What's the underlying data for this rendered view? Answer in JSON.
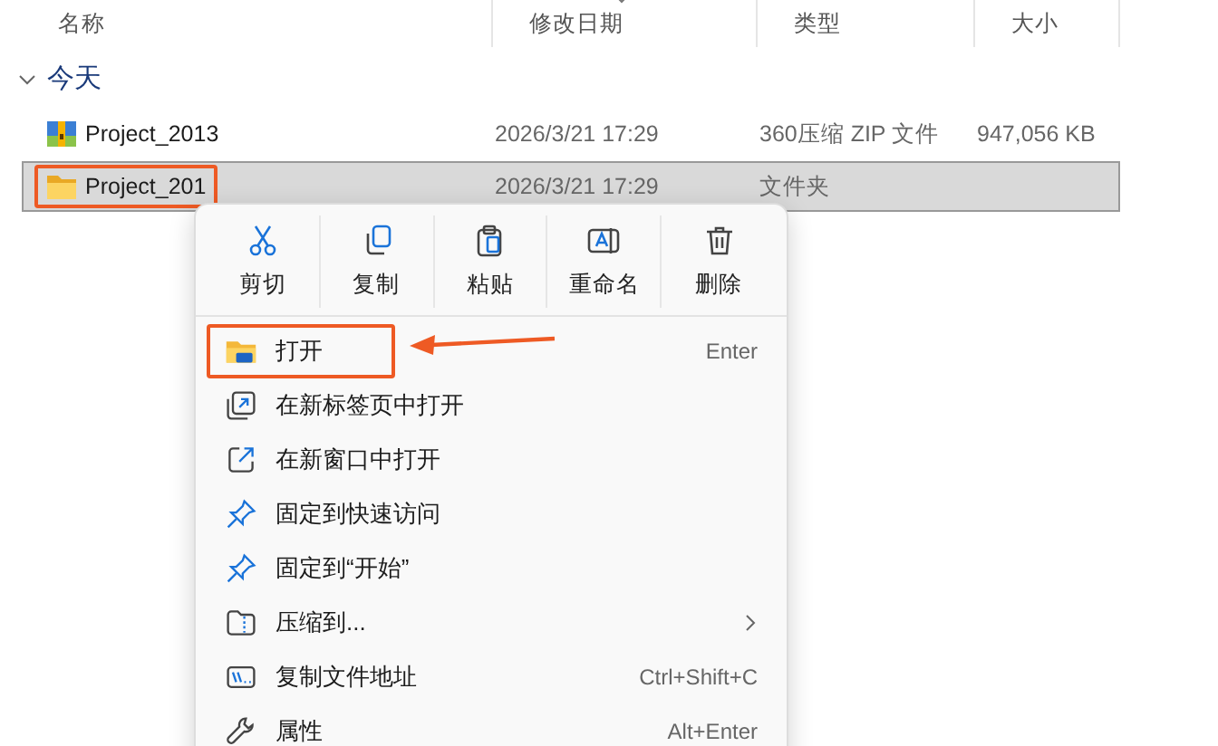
{
  "columns": [
    {
      "label": "名称"
    },
    {
      "label": "修改日期"
    },
    {
      "label": "类型"
    },
    {
      "label": "大小"
    }
  ],
  "group": {
    "label": "今天",
    "expanded": true
  },
  "rows": [
    {
      "kind": "zip",
      "name": "Project_2013",
      "date": "2026/3/21 17:29",
      "type": "360压缩 ZIP 文件",
      "size": "947,056 KB",
      "selected": false,
      "highlighted": false
    },
    {
      "kind": "folder",
      "name": "Project_201",
      "date": "2026/3/21 17:29",
      "type": "文件夹",
      "selected": true,
      "highlighted": true
    }
  ],
  "context_menu": {
    "toolbar": [
      {
        "kind": "cut",
        "label": "剪切"
      },
      {
        "kind": "copy",
        "label": "复制"
      },
      {
        "kind": "paste",
        "label": "粘贴"
      },
      {
        "kind": "rename",
        "label": "重命名"
      },
      {
        "kind": "delete",
        "label": "删除"
      }
    ],
    "items": [
      {
        "kind": "open",
        "label": "打开",
        "shortcut": "Enter",
        "highlighted": true
      },
      {
        "kind": "newtab",
        "label": "在新标签页中打开",
        "highlighted": false
      },
      {
        "kind": "newwindow",
        "label": "在新窗口中打开",
        "highlighted": false
      },
      {
        "kind": "pin",
        "label": "固定到快速访问",
        "highlighted": false
      },
      {
        "kind": "pin",
        "label": "固定到“开始”",
        "highlighted": false
      },
      {
        "kind": "zip",
        "label": "压缩到...",
        "submenu": true,
        "highlighted": false
      },
      {
        "kind": "path",
        "label": "复制文件地址",
        "shortcut": "Ctrl+Shift+C",
        "highlighted": false
      },
      {
        "kind": "properties",
        "label": "属性",
        "shortcut": "Alt+Enter",
        "highlighted": false
      }
    ]
  }
}
